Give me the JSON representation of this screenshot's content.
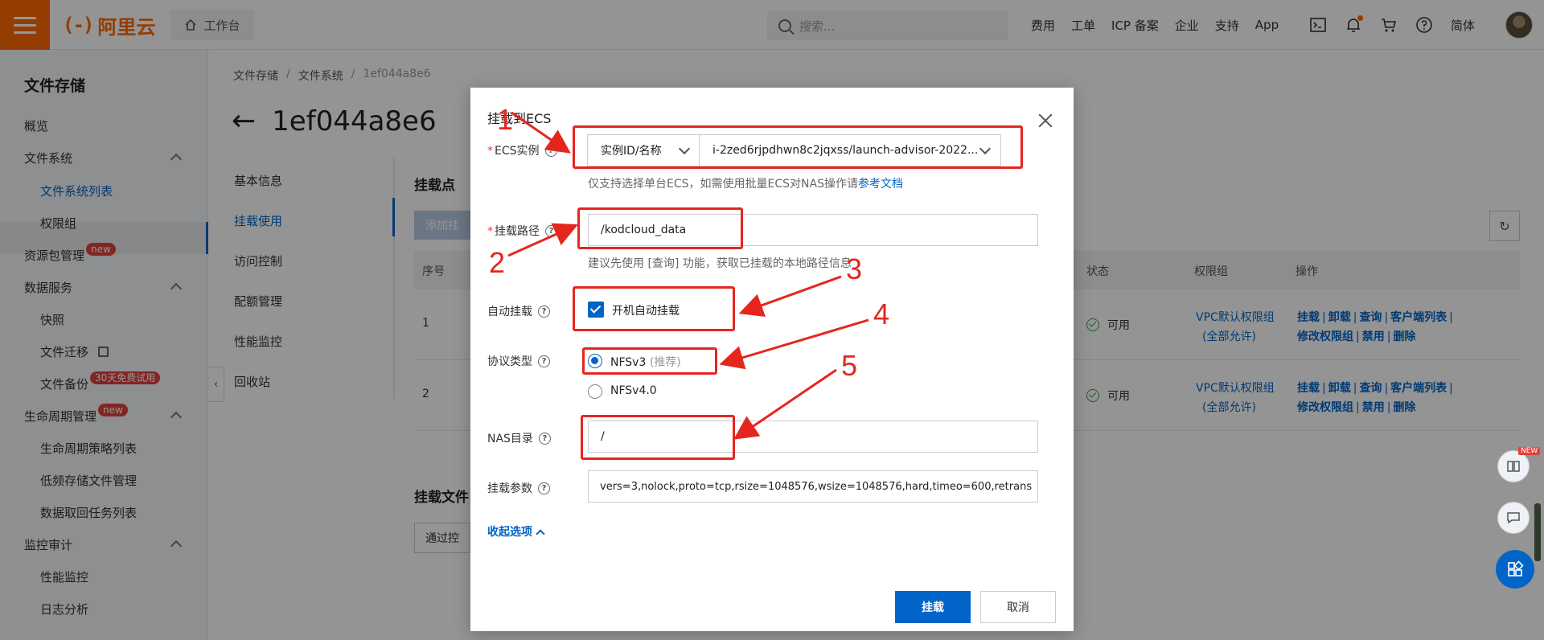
{
  "topbar": {
    "logo_text": "阿里云",
    "logo_mark": "(-)",
    "workbench": "工作台",
    "search_placeholder": "搜索...",
    "nav": [
      "费用",
      "工单",
      "ICP 备案",
      "企业",
      "支持",
      "App"
    ],
    "lang": "简体",
    "icons": [
      "terminal-icon",
      "bell-icon",
      "cart-icon",
      "help-icon"
    ]
  },
  "sidebar": {
    "title": "文件存储",
    "items": [
      {
        "label": "概览"
      },
      {
        "label": "文件系统"
      },
      {
        "label": "文件系统列表"
      },
      {
        "label": "权限组"
      },
      {
        "label": "资源包管理",
        "badge": "new"
      },
      {
        "label": "数据服务"
      },
      {
        "label": "快照"
      },
      {
        "label": "文件迁移"
      },
      {
        "label": "文件备份",
        "badge": "30天免费试用"
      },
      {
        "label": "生命周期管理",
        "badge": "new"
      },
      {
        "label": "生命周期策略列表"
      },
      {
        "label": "低频存储文件管理"
      },
      {
        "label": "数据取回任务列表"
      },
      {
        "label": "监控审计"
      },
      {
        "label": "性能监控"
      },
      {
        "label": "日志分析"
      }
    ]
  },
  "breadcrumb": [
    "文件存储",
    "/",
    "文件系统",
    "/",
    "1ef044a8e6"
  ],
  "page_title": "1ef044a8e6",
  "subnav": [
    "基本信息",
    "挂载使用",
    "访问控制",
    "配额管理",
    "性能监控",
    "回收站"
  ],
  "mount": {
    "section_title": "挂载点",
    "add_button": "添加挂",
    "columns": {
      "index": "序号",
      "status": "状态",
      "perm": "权限组",
      "ops": "操作"
    },
    "rows": [
      {
        "index": "1",
        "status": "可用",
        "perm1": "VPC默认权限组",
        "perm2": "(全部允许)"
      },
      {
        "index": "2",
        "status": "可用",
        "perm1": "VPC默认权限组",
        "perm2": "(全部允许)"
      }
    ],
    "ops_line1": [
      "挂载",
      "卸载",
      "查询",
      "客户端列表"
    ],
    "ops_line2": [
      "修改权限组",
      "禁用",
      "删除"
    ],
    "sep": "|"
  },
  "bottom": {
    "title": "挂载文件",
    "button": "通过控"
  },
  "modal": {
    "title": "挂载到ECS",
    "ecs_label": "ECS实例",
    "ecs_type": "实例ID/名称",
    "ecs_instance": "i-2zed6rjpdhwn8c2jqxss/launch-advisor-2022...",
    "ecs_hint": "仅支持选择单台ECS，如需使用批量ECS对NAS操作请",
    "ecs_hint_link": "参考文档",
    "path_label": "挂载路径",
    "path_value": "/kodcloud_data",
    "path_hint": "建议先使用 [查询] 功能，获取已挂载的本地路径信息",
    "auto_label": "自动挂载",
    "auto_option": "开机自动挂载",
    "auto_checked": true,
    "proto_label": "协议类型",
    "proto_options": [
      {
        "label": "NFSv3",
        "note": "(推荐)",
        "selected": true
      },
      {
        "label": "NFSv4.0",
        "selected": false
      }
    ],
    "nas_label": "NAS目录",
    "nas_value": "/",
    "params_label": "挂载参数",
    "params_value": "vers=3,nolock,proto=tcp,rsize=1048576,wsize=1048576,hard,timeo=600,retrans",
    "collapse": "收起选项",
    "ok": "挂载",
    "cancel": "取消"
  },
  "annotations": [
    "1",
    "2",
    "3",
    "4",
    "5"
  ],
  "floating": {
    "new_tag": "NEW"
  },
  "colors": {
    "brand": "#ff6a00",
    "primary": "#0064c8",
    "annotation": "#e5261f",
    "success": "#2aa34a"
  }
}
